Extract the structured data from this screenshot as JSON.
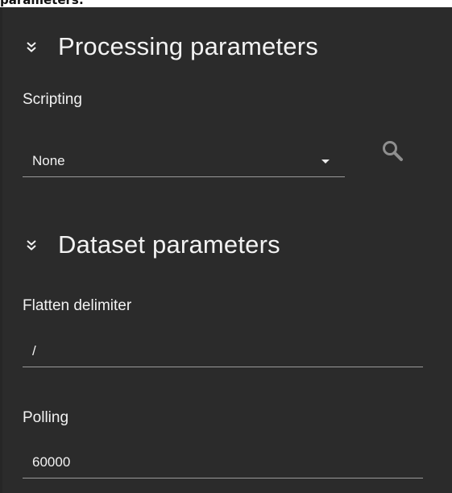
{
  "top_fragment": "parameters:",
  "processing": {
    "title": "Processing parameters",
    "scripting_label": "Scripting",
    "scripting_value": "None"
  },
  "dataset": {
    "title": "Dataset parameters",
    "flatten_label": "Flatten delimiter",
    "flatten_value": "/",
    "polling_label": "Polling",
    "polling_value": "60000"
  },
  "colors": {
    "panel_bg": "#2b2b2b",
    "text": "#f2f2f2",
    "underline": "#9a9a9a",
    "icon": "#8f8f8f"
  },
  "icons": {
    "collapse": "double-chevron-down-icon",
    "search": "search-icon",
    "dropdown": "caret-down-icon"
  }
}
